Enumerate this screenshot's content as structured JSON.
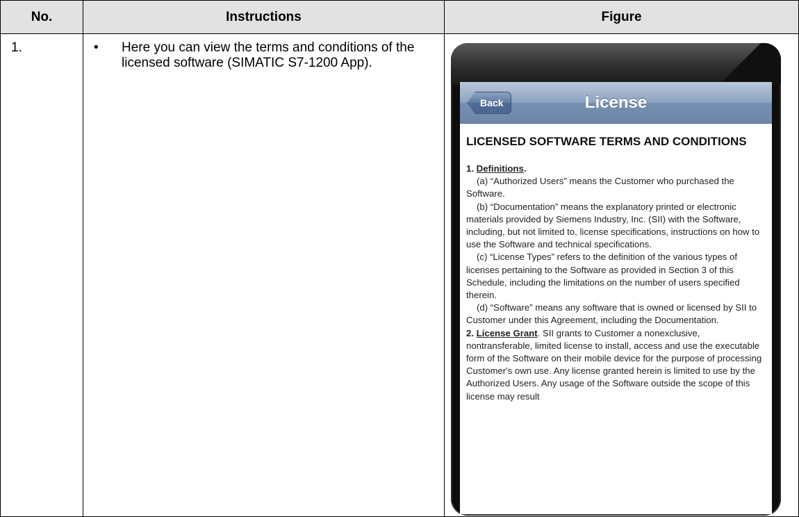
{
  "table": {
    "headers": {
      "no": "No.",
      "instructions": "Instructions",
      "figure": "Figure"
    }
  },
  "step": {
    "number": "1.",
    "instructions": [
      "Here you can view the terms and conditions of the licensed software (SIMATIC S7-1200 App)."
    ]
  },
  "phone": {
    "nav": {
      "back_label": "Back",
      "title": "License"
    },
    "license": {
      "heading": "LICENSED SOFTWARE TERMS AND CONDITIONS",
      "section1_num": "1. ",
      "section1_title": "Definitions",
      "section1_end": ".",
      "def_a": "(a) “Authorized Users” means the Customer who purchased the Software.",
      "def_b": "(b) “Documentation” means the explanatory printed or electronic materials provided by Siemens Industry, Inc. (SII) with the Software, including, but not limited to, license specifications, instructions on how to use the Software and technical specifications.",
      "def_c": "(c) “License Types” refers to the definition of the various types of licenses pertaining to the Software as provided in Section 3 of this Schedule, including the limitations on the number of users specified therein.",
      "def_d": "(d) “Software” means any software that is owned or licensed by SII to Customer under this Agreement, including the Documentation.",
      "section2_num": "2. ",
      "section2_title": "License Grant",
      "section2_text": ". SII grants to Customer a nonexclusive, nontransferable, limited license to install, access and use the executable form of the Software on their mobile device for the purpose of processing Customer's own use. Any license granted herein is limited to use by the Authorized Users. Any usage of the Software outside the scope of this license may result"
    }
  }
}
